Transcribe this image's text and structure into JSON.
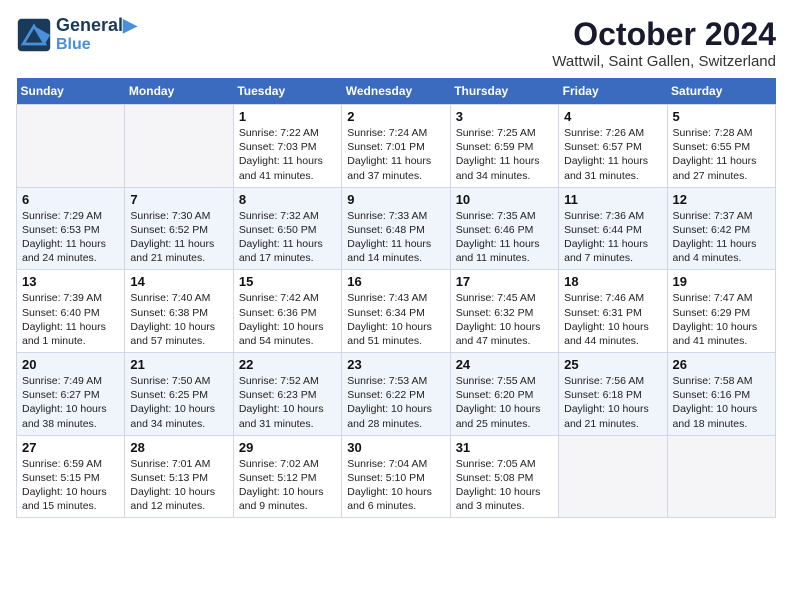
{
  "header": {
    "logo_line1": "General",
    "logo_line2": "Blue",
    "month": "October 2024",
    "location": "Wattwil, Saint Gallen, Switzerland"
  },
  "weekdays": [
    "Sunday",
    "Monday",
    "Tuesday",
    "Wednesday",
    "Thursday",
    "Friday",
    "Saturday"
  ],
  "weeks": [
    [
      {
        "day": "",
        "info": ""
      },
      {
        "day": "",
        "info": ""
      },
      {
        "day": "1",
        "info": "Sunrise: 7:22 AM\nSunset: 7:03 PM\nDaylight: 11 hours and 41 minutes."
      },
      {
        "day": "2",
        "info": "Sunrise: 7:24 AM\nSunset: 7:01 PM\nDaylight: 11 hours and 37 minutes."
      },
      {
        "day": "3",
        "info": "Sunrise: 7:25 AM\nSunset: 6:59 PM\nDaylight: 11 hours and 34 minutes."
      },
      {
        "day": "4",
        "info": "Sunrise: 7:26 AM\nSunset: 6:57 PM\nDaylight: 11 hours and 31 minutes."
      },
      {
        "day": "5",
        "info": "Sunrise: 7:28 AM\nSunset: 6:55 PM\nDaylight: 11 hours and 27 minutes."
      }
    ],
    [
      {
        "day": "6",
        "info": "Sunrise: 7:29 AM\nSunset: 6:53 PM\nDaylight: 11 hours and 24 minutes."
      },
      {
        "day": "7",
        "info": "Sunrise: 7:30 AM\nSunset: 6:52 PM\nDaylight: 11 hours and 21 minutes."
      },
      {
        "day": "8",
        "info": "Sunrise: 7:32 AM\nSunset: 6:50 PM\nDaylight: 11 hours and 17 minutes."
      },
      {
        "day": "9",
        "info": "Sunrise: 7:33 AM\nSunset: 6:48 PM\nDaylight: 11 hours and 14 minutes."
      },
      {
        "day": "10",
        "info": "Sunrise: 7:35 AM\nSunset: 6:46 PM\nDaylight: 11 hours and 11 minutes."
      },
      {
        "day": "11",
        "info": "Sunrise: 7:36 AM\nSunset: 6:44 PM\nDaylight: 11 hours and 7 minutes."
      },
      {
        "day": "12",
        "info": "Sunrise: 7:37 AM\nSunset: 6:42 PM\nDaylight: 11 hours and 4 minutes."
      }
    ],
    [
      {
        "day": "13",
        "info": "Sunrise: 7:39 AM\nSunset: 6:40 PM\nDaylight: 11 hours and 1 minute."
      },
      {
        "day": "14",
        "info": "Sunrise: 7:40 AM\nSunset: 6:38 PM\nDaylight: 10 hours and 57 minutes."
      },
      {
        "day": "15",
        "info": "Sunrise: 7:42 AM\nSunset: 6:36 PM\nDaylight: 10 hours and 54 minutes."
      },
      {
        "day": "16",
        "info": "Sunrise: 7:43 AM\nSunset: 6:34 PM\nDaylight: 10 hours and 51 minutes."
      },
      {
        "day": "17",
        "info": "Sunrise: 7:45 AM\nSunset: 6:32 PM\nDaylight: 10 hours and 47 minutes."
      },
      {
        "day": "18",
        "info": "Sunrise: 7:46 AM\nSunset: 6:31 PM\nDaylight: 10 hours and 44 minutes."
      },
      {
        "day": "19",
        "info": "Sunrise: 7:47 AM\nSunset: 6:29 PM\nDaylight: 10 hours and 41 minutes."
      }
    ],
    [
      {
        "day": "20",
        "info": "Sunrise: 7:49 AM\nSunset: 6:27 PM\nDaylight: 10 hours and 38 minutes."
      },
      {
        "day": "21",
        "info": "Sunrise: 7:50 AM\nSunset: 6:25 PM\nDaylight: 10 hours and 34 minutes."
      },
      {
        "day": "22",
        "info": "Sunrise: 7:52 AM\nSunset: 6:23 PM\nDaylight: 10 hours and 31 minutes."
      },
      {
        "day": "23",
        "info": "Sunrise: 7:53 AM\nSunset: 6:22 PM\nDaylight: 10 hours and 28 minutes."
      },
      {
        "day": "24",
        "info": "Sunrise: 7:55 AM\nSunset: 6:20 PM\nDaylight: 10 hours and 25 minutes."
      },
      {
        "day": "25",
        "info": "Sunrise: 7:56 AM\nSunset: 6:18 PM\nDaylight: 10 hours and 21 minutes."
      },
      {
        "day": "26",
        "info": "Sunrise: 7:58 AM\nSunset: 6:16 PM\nDaylight: 10 hours and 18 minutes."
      }
    ],
    [
      {
        "day": "27",
        "info": "Sunrise: 6:59 AM\nSunset: 5:15 PM\nDaylight: 10 hours and 15 minutes."
      },
      {
        "day": "28",
        "info": "Sunrise: 7:01 AM\nSunset: 5:13 PM\nDaylight: 10 hours and 12 minutes."
      },
      {
        "day": "29",
        "info": "Sunrise: 7:02 AM\nSunset: 5:12 PM\nDaylight: 10 hours and 9 minutes."
      },
      {
        "day": "30",
        "info": "Sunrise: 7:04 AM\nSunset: 5:10 PM\nDaylight: 10 hours and 6 minutes."
      },
      {
        "day": "31",
        "info": "Sunrise: 7:05 AM\nSunset: 5:08 PM\nDaylight: 10 hours and 3 minutes."
      },
      {
        "day": "",
        "info": ""
      },
      {
        "day": "",
        "info": ""
      }
    ]
  ]
}
